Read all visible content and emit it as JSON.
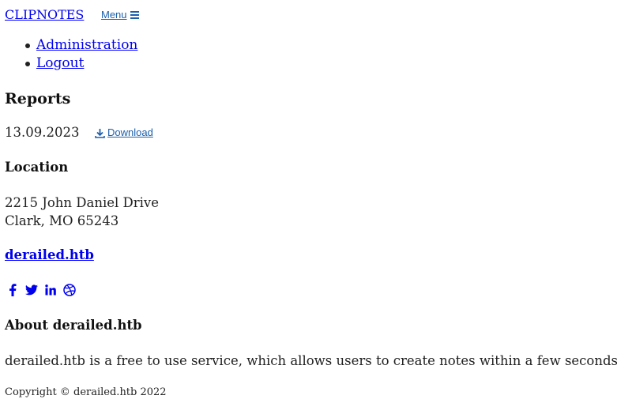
{
  "header": {
    "brand": "CLIPNOTES",
    "menu_label": "Menu"
  },
  "nav": {
    "items": [
      {
        "label": "Administration"
      },
      {
        "label": "Logout"
      }
    ]
  },
  "reports": {
    "heading": "Reports",
    "date": "13.09.2023",
    "download_label": "Download"
  },
  "location": {
    "heading": "Location",
    "address_line1": "2215 John Daniel Drive",
    "address_line2": "Clark, MO 65243"
  },
  "site": {
    "link": "derailed.htb"
  },
  "social": {
    "icons": [
      "facebook-icon",
      "twitter-icon",
      "linkedin-icon",
      "dribbble-icon"
    ],
    "color": "#0000ee"
  },
  "about": {
    "heading": "About derailed.htb",
    "text": "derailed.htb is a free to use service, which allows users to create notes within a few seconds."
  },
  "footer": {
    "copyright": "Copyright © derailed.htb 2022"
  }
}
